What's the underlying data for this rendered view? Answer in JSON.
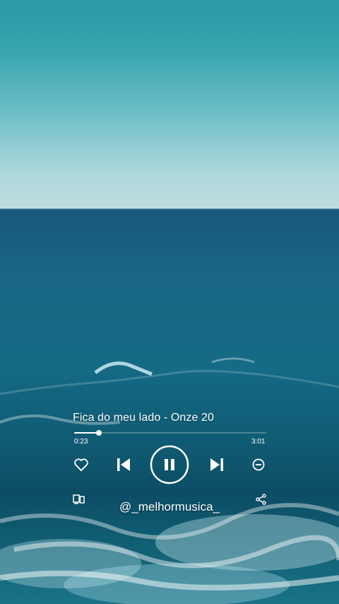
{
  "player": {
    "track": "Fica do meu lado - Onze 20",
    "elapsed": "0:23",
    "duration": "3:01",
    "progress_fraction": 0.127,
    "state": "playing",
    "controls": [
      "heart-icon",
      "skip-previous-icon",
      "pause-icon",
      "skip-next-icon",
      "minus-circle-icon",
      "devices-icon",
      "share-icon"
    ]
  },
  "footer": {
    "handle": "@_melhormusica_"
  },
  "colors": {
    "accent": "#ffffff",
    "sky": "#3aa6b0",
    "sea": "#135f7c"
  }
}
